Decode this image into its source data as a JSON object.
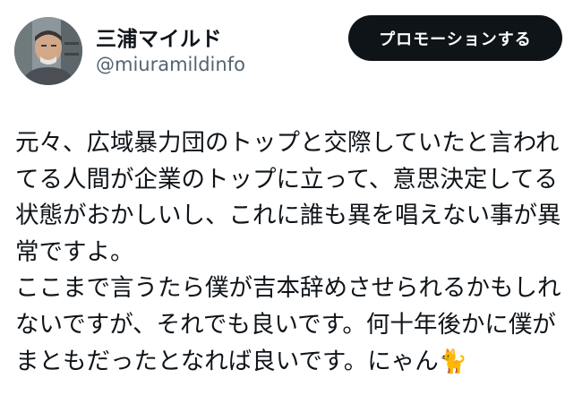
{
  "user": {
    "display_name": "三浦マイルド",
    "handle": "@miuramildinfo"
  },
  "promote_button_label": "プロモーションする",
  "tweet": {
    "lines": [
      "元々、広域暴力団のトップと交際していたと言われ",
      "てる人間が企業のトップに立って、意思決定してる",
      "状態がおかしいし、これに誰も異を唱えない事が異",
      "常ですよ。",
      "ここまで言うたら僕が吉本辞めさせられるかもしれ",
      "ないですが、それでも良いです。何十年後かに僕が",
      "まともだったとなれば良いです。にゃん"
    ],
    "emoji": "🐈"
  }
}
